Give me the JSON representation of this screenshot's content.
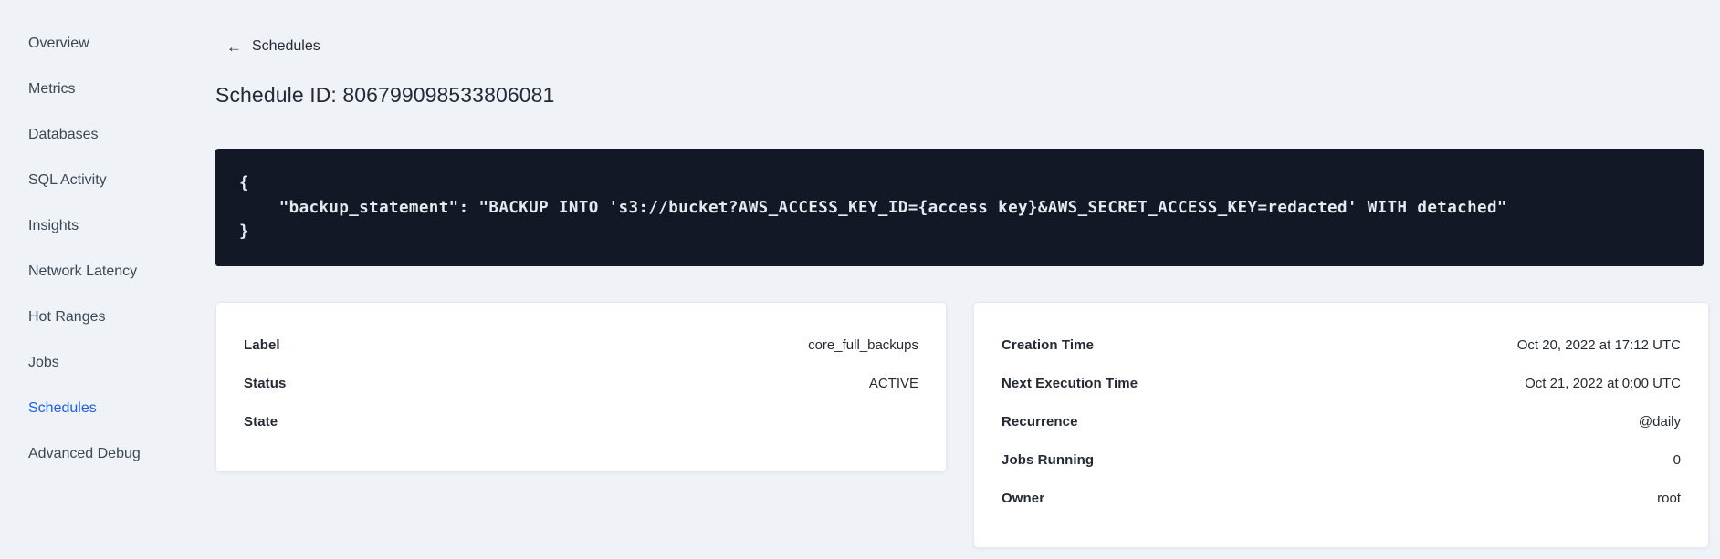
{
  "sidebar": {
    "items": [
      {
        "label": "Overview"
      },
      {
        "label": "Metrics"
      },
      {
        "label": "Databases"
      },
      {
        "label": "SQL Activity"
      },
      {
        "label": "Insights"
      },
      {
        "label": "Network Latency"
      },
      {
        "label": "Hot Ranges"
      },
      {
        "label": "Jobs"
      },
      {
        "label": "Schedules"
      },
      {
        "label": "Advanced Debug"
      }
    ],
    "active_item": "Schedules"
  },
  "header": {
    "back_icon": "←",
    "back_label": "Schedules",
    "title": "Schedule ID: 806799098533806081"
  },
  "code_block": {
    "lines": [
      "{",
      "    \"backup_statement\": \"BACKUP INTO 's3://bucket?AWS_ACCESS_KEY_ID={access key}&AWS_SECRET_ACCESS_KEY=redacted' WITH detached\"",
      "}"
    ]
  },
  "details_left": {
    "rows": [
      {
        "label": "Label",
        "value": "core_full_backups"
      },
      {
        "label": "Status",
        "value": "ACTIVE"
      },
      {
        "label": "State",
        "value": ""
      }
    ]
  },
  "details_right": {
    "rows": [
      {
        "label": "Creation Time",
        "value": "Oct 20, 2022 at 17:12 UTC"
      },
      {
        "label": "Next Execution Time",
        "value": "Oct 21, 2022 at 0:00 UTC"
      },
      {
        "label": "Recurrence",
        "value": "@daily"
      },
      {
        "label": "Jobs Running",
        "value": "0"
      },
      {
        "label": "Owner",
        "value": "root"
      }
    ]
  },
  "colors": {
    "page_background": "#eff3f7",
    "sidebar_active_link": "#2060e8",
    "code_block_background": "#121826",
    "code_text": "#e4e8ef",
    "text_primary": "#242a35",
    "card_background": "#ffffff"
  }
}
